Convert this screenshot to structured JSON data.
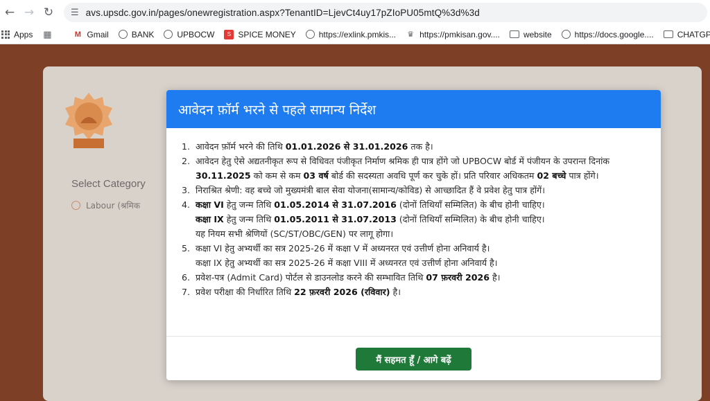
{
  "browser": {
    "url": "avs.upsdc.gov.in/pages/onewregistration.aspx?TenantID=LjevCt4uy17pZIoPU05mtQ%3d%3d",
    "bookmarks": [
      {
        "label": "Apps",
        "icon": "apps-grid-icon"
      },
      {
        "label": "",
        "icon": "grid-icon"
      },
      {
        "label": "Gmail",
        "icon": "gmail-icon"
      },
      {
        "label": "BANK",
        "icon": "globe-icon"
      },
      {
        "label": "UPBOCW",
        "icon": "globe-icon"
      },
      {
        "label": "SPICE MONEY",
        "icon": "spice-money-icon"
      },
      {
        "label": "https://exlink.pmkis...",
        "icon": "globe-icon"
      },
      {
        "label": "https://pmkisan.gov....",
        "icon": "emblem-icon"
      },
      {
        "label": "website",
        "icon": "folder-icon"
      },
      {
        "label": "https://docs.google....",
        "icon": "globe-icon"
      },
      {
        "label": "CHATGPT",
        "icon": "folder-icon"
      }
    ]
  },
  "background": {
    "select_category": "Select Category",
    "labour_option": "Labour (श्रमिक"
  },
  "modal": {
    "title": "आवेदन फ़ॉर्म भरने से पहले सामान्य निर्देश",
    "items": [
      {
        "n": "1.",
        "parts": [
          "आवेदन फ़ॉर्म भरने की तिथि ",
          "01.01.2026 से 31.01.2026",
          " तक है।"
        ]
      },
      {
        "n": "2.",
        "parts": [
          "आवेदन हेतु ऐसे अद्यतनीकृत रूप से विधिवत पंजीकृत निर्माण श्रमिक ही पात्र होंगे जो UPBOCW बोर्ड में पंजीयन के उपरान्त दिनांक ",
          "30.11.2025",
          " को कम से कम ",
          "03 वर्ष",
          " बोर्ड की सदस्यता अवधि पूर्ण कर चुके हों। प्रति परिवार अधिकतम ",
          "02 बच्चे",
          " पात्र होंगे।"
        ]
      },
      {
        "n": "3.",
        "parts": [
          "निराश्रित श्रेणी: वह बच्चे जो मुख्यमंत्री बाल सेवा योजना(सामान्य/कोविड) से आच्छादित हैं वे प्रवेश हेतु पात्र होंगें।"
        ]
      },
      {
        "n": "4.",
        "line1": [
          "कक्षा VI",
          " हेतु जन्म तिथि ",
          "01.05.2014 से 31.07.2016",
          " (दोनों तिथियाँ सम्मिलित) के बीच होनी चाहिए।"
        ],
        "line2": [
          "कक्षा IX",
          " हेतु जन्म तिथि ",
          "01.05.2011 से 31.07.2013",
          " (दोनों तिथियाँ सम्मिलित) के बीच होनी चाहिए।"
        ],
        "line3": "यह नियम सभी श्रेणियों (SC/ST/OBC/GEN) पर लागू होगा।"
      },
      {
        "n": "5.",
        "line1": "कक्षा VI हेतु अभ्यर्थी का सत्र 2025-26 में कक्षा V में अध्यनरत एवं उत्तीर्ण होना अनिवार्य है।",
        "line2": "कक्षा IX हेतु अभ्यर्थी का सत्र 2025-26 में कक्षा VIII में अध्यनरत एवं उत्तीर्ण होना अनिवार्य है।"
      },
      {
        "n": "6.",
        "parts": [
          "प्रवेश-पत्र (Admit Card) पोर्टल से डाउनलोड करने की सम्भावित तिथि ",
          "07 फ़रवरी 2026",
          " है।"
        ]
      },
      {
        "n": "7.",
        "parts": [
          "प्रवेश परीक्षा की निर्धारित तिथि ",
          "22 फ़रवरी 2026 (रविवार)",
          " है।"
        ]
      }
    ],
    "agree_button": "मैं सहमत हूँ / आगे बढ़ें"
  },
  "colors": {
    "header_blue": "#1e7bf0",
    "button_green": "#1f7a3a",
    "page_brown": "#7d4027"
  }
}
